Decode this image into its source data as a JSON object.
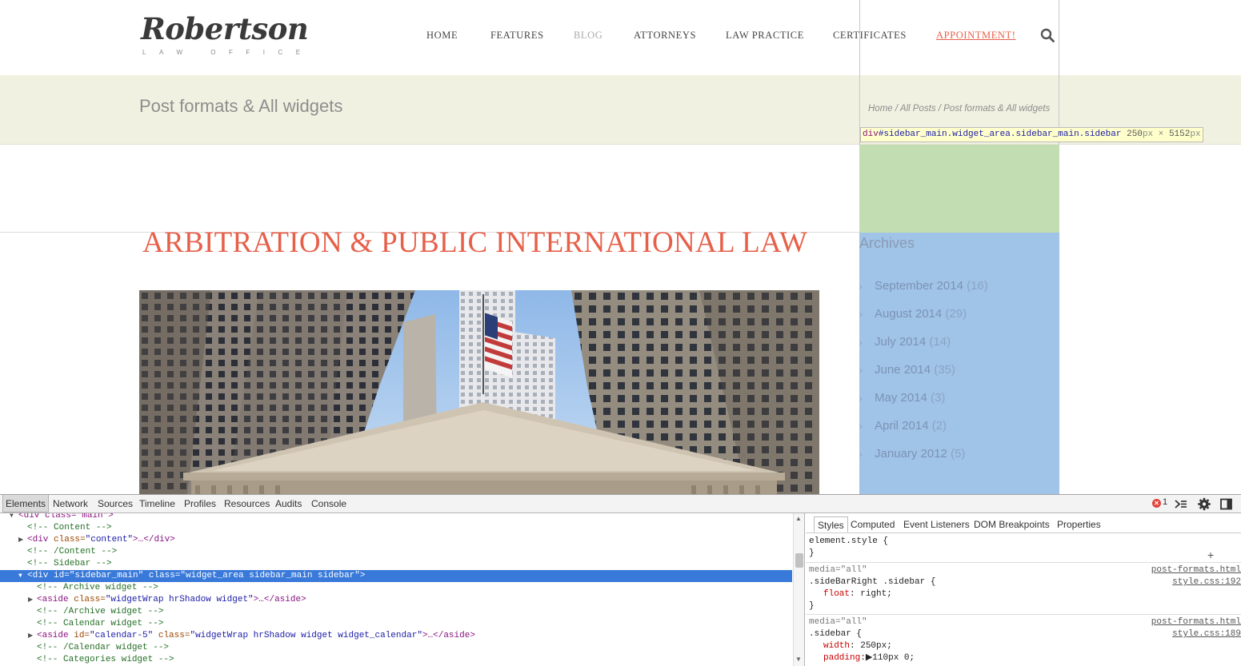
{
  "site": {
    "logo_name": "Robertson",
    "logo_sub": "LAW OFFICE",
    "nav": [
      {
        "label": "HOME",
        "state": "normal"
      },
      {
        "label": "FEATURES",
        "state": "normal"
      },
      {
        "label": "BLOG",
        "state": "dim"
      },
      {
        "label": "ATTORNEYS",
        "state": "normal"
      },
      {
        "label": "LAW PRACTICE",
        "state": "normal"
      },
      {
        "label": "CERTIFICATES",
        "state": "normal"
      },
      {
        "label": "APPOINTMENT!",
        "state": "accent"
      }
    ],
    "search_icon": "search-icon",
    "accent_color": "#e7604a"
  },
  "title_band": {
    "title": "Post formats & All widgets",
    "breadcrumb": "Home / All Posts / Post formats & All widgets"
  },
  "post": {
    "title": "ARBITRATION & PUBLIC INTERNATIONAL LAW"
  },
  "sidebar": {
    "tooltip": {
      "tag": "div",
      "id": "#sidebar_main",
      "classes": ".widget_area.sidebar_main.sidebar",
      "width": "250",
      "height": "5152",
      "unit": "px",
      "times": "×"
    },
    "archives_title": "Archives",
    "archives": [
      {
        "label": "September 2014",
        "count": "(16)"
      },
      {
        "label": "August 2014",
        "count": "(29)"
      },
      {
        "label": "July 2014",
        "count": "(14)"
      },
      {
        "label": "June 2014",
        "count": "(35)"
      },
      {
        "label": "May 2014",
        "count": "(3)"
      },
      {
        "label": "April 2014",
        "count": "(2)"
      },
      {
        "label": "January 2012",
        "count": "(5)"
      }
    ]
  },
  "devtools": {
    "tabs": [
      "Elements",
      "Network",
      "Sources",
      "Timeline",
      "Profiles",
      "Resources",
      "Audits",
      "Console"
    ],
    "active_tab": "Elements",
    "error_count": "1",
    "dom_lines": [
      {
        "indent": 1,
        "tri": "▼",
        "kind": "partial",
        "text": "<div class=\"main\">"
      },
      {
        "indent": 2,
        "tri": "",
        "kind": "comment",
        "text": "<!-- Content -->"
      },
      {
        "indent": 2,
        "tri": "▶",
        "kind": "tag",
        "tag_open": "<div ",
        "attr": "class=",
        "val": "\"content\"",
        "rest": ">…</div>"
      },
      {
        "indent": 2,
        "tri": "",
        "kind": "comment",
        "text": "<!-- /Content -->"
      },
      {
        "indent": 2,
        "tri": "",
        "kind": "comment",
        "text": "<!-- Sidebar -->"
      },
      {
        "indent": 2,
        "tri": "▼",
        "kind": "selected",
        "text": "<div id=\"sidebar_main\" class=\"widget_area sidebar_main sidebar\">"
      },
      {
        "indent": 3,
        "tri": "",
        "kind": "comment",
        "text": "<!-- Archive widget -->"
      },
      {
        "indent": 3,
        "tri": "▶",
        "kind": "tag",
        "tag_open": "<aside ",
        "attr": "class=",
        "val": "\"widgetWrap hrShadow widget\"",
        "rest": ">…</aside>"
      },
      {
        "indent": 3,
        "tri": "",
        "kind": "comment",
        "text": "<!-- /Archive widget -->"
      },
      {
        "indent": 3,
        "tri": "",
        "kind": "comment",
        "text": "<!-- Calendar widget -->"
      },
      {
        "indent": 3,
        "tri": "▶",
        "kind": "tag2",
        "tag_open": "<aside ",
        "attr": "id=",
        "val": "\"calendar-5\"",
        "attr2": " class=",
        "val2": "\"widgetWrap hrShadow widget widget_calendar\"",
        "rest": ">…</aside>"
      },
      {
        "indent": 3,
        "tri": "",
        "kind": "comment",
        "text": "<!-- /Calendar widget -->"
      },
      {
        "indent": 3,
        "tri": "",
        "kind": "comment",
        "text": "<!-- Categories widget -->"
      }
    ],
    "styles_tabs": [
      "Styles",
      "Computed",
      "Event Listeners",
      "DOM Breakpoints",
      "Properties"
    ],
    "styles_active": "Styles",
    "rules": {
      "element_style_open": "element.style {",
      "close": "}",
      "rule1_media": "media=\"all\"",
      "rule1_selector": ".sideBarRight .sidebar {",
      "rule1_prop": "float",
      "rule1_value": "right;",
      "rule1_file": "post-formats.html",
      "rule1_src": "style.css:192",
      "rule2_media": "media=\"all\"",
      "rule2_selector": ".sidebar {",
      "rule2_prop1": "width",
      "rule2_value1": "250px;",
      "rule2_prop2": "padding",
      "rule2_value2": "110px 0;",
      "rule2_file": "post-formats.html",
      "rule2_src": "style.css:189"
    }
  }
}
